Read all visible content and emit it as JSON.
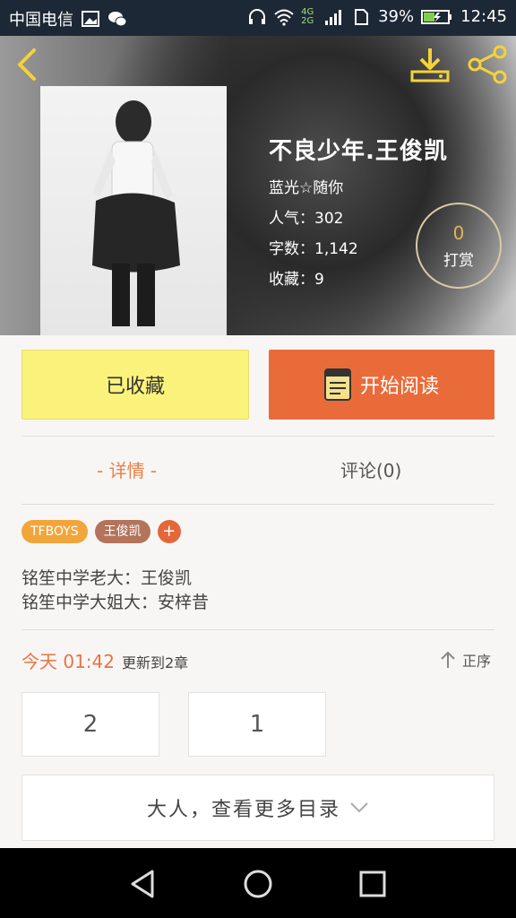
{
  "status": {
    "carrier": "中国电信",
    "network": "4G 2G",
    "battery": "39%",
    "time": "12:45"
  },
  "book": {
    "title": "不良少年.王俊凯",
    "author": "蓝光☆随你",
    "popularity": "人气：302",
    "words": "字数：1,142",
    "favorites": "收藏：9",
    "reward_count": "0",
    "reward_label": "打赏"
  },
  "buttons": {
    "fav": "已收藏",
    "read": "开始阅读"
  },
  "tabs": {
    "detail": "- 详情 -",
    "comments": "评论(0)"
  },
  "tags": {
    "tag1": "TFBOYS",
    "tag2": "王俊凯",
    "add": "+"
  },
  "description": {
    "line1": "铭笙中学老大：王俊凯",
    "line2": "铭笙中学大姐大：安梓昔"
  },
  "update": {
    "time": "今天 01:42",
    "text": "更新到2章",
    "order": "正序"
  },
  "chapters": [
    "2",
    "1"
  ],
  "more": "大人，查看更多目录",
  "colors": {
    "accent_orange": "#ea6b3a",
    "fav_yellow": "#fbf27c",
    "tag_tfboys": "#f1a53a",
    "tag_wang": "#b4735b"
  }
}
